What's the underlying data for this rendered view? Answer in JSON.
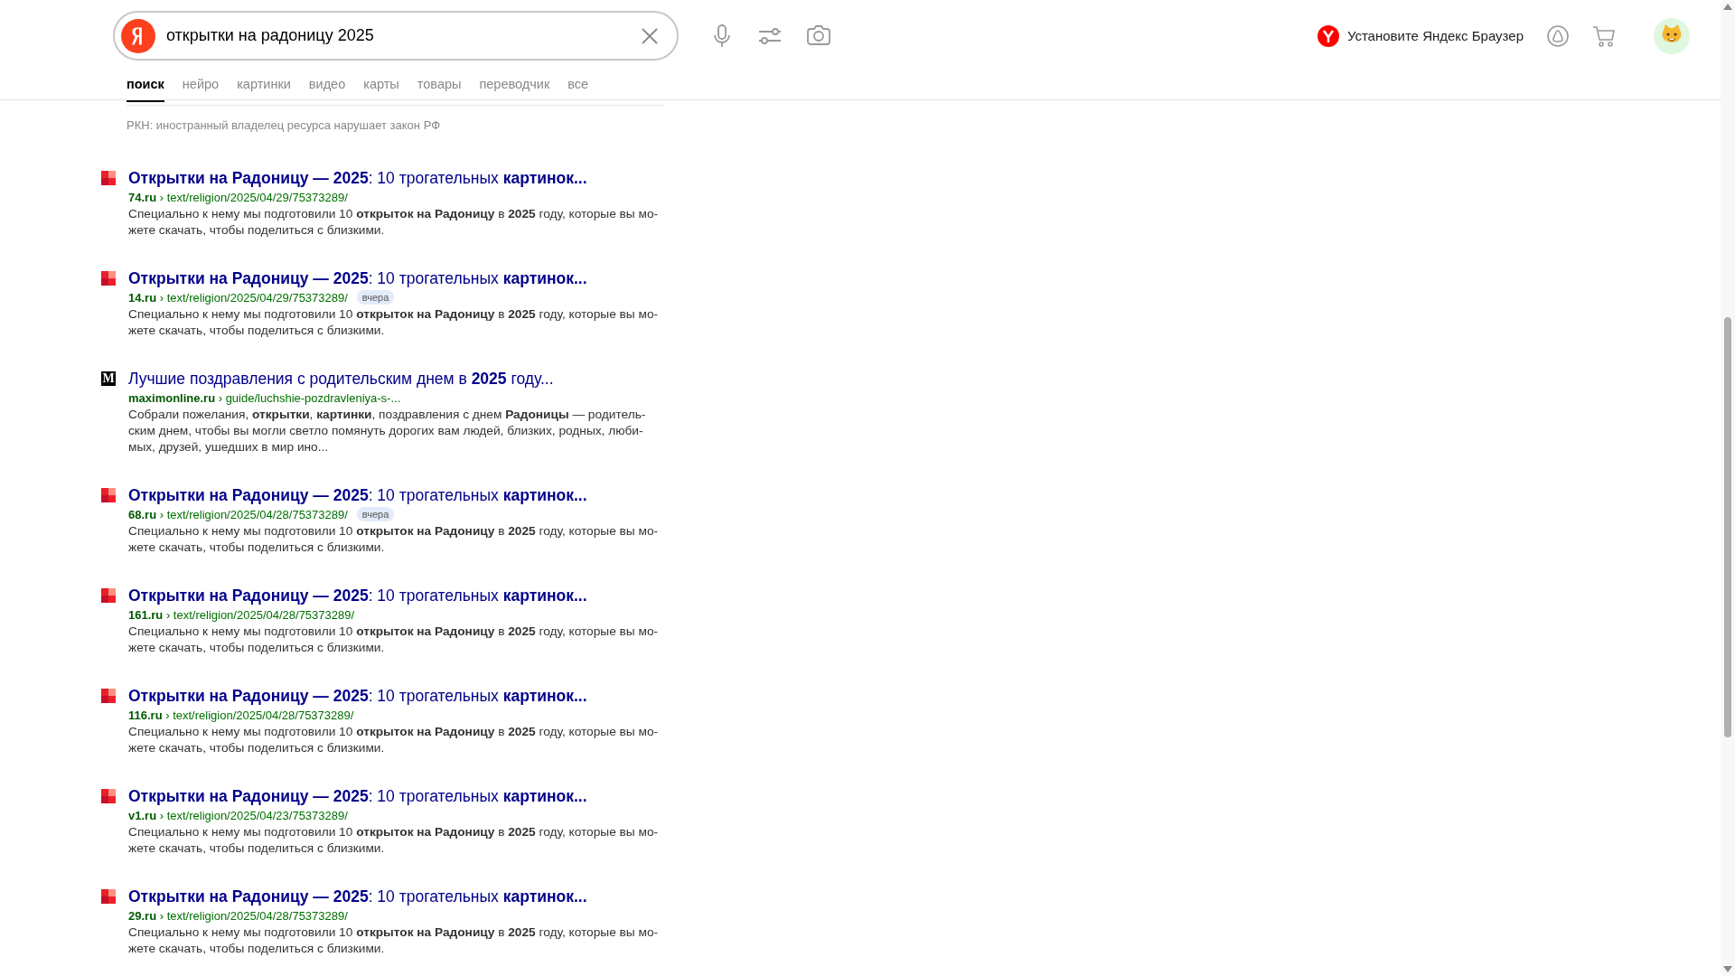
{
  "search": {
    "value": "открытки на радоницу 2025"
  },
  "promo": {
    "label": "Установите Яндекс Браузер"
  },
  "tabs": [
    {
      "label": "поиск",
      "selected": true
    },
    {
      "label": "нейро",
      "selected": false
    },
    {
      "label": "картинки",
      "selected": false
    },
    {
      "label": "видео",
      "selected": false
    },
    {
      "label": "карты",
      "selected": false
    },
    {
      "label": "товары",
      "selected": false
    },
    {
      "label": "переводчик",
      "selected": false
    },
    {
      "label": "все",
      "selected": false
    }
  ],
  "notice": "РКН: иностранный владелец ресурса нарушает закон РФ",
  "results": [
    {
      "kind": "squares",
      "title": "**Открытки на Радоницу — 2025**: 10 трогательных **картинок...**",
      "url": "**74.ru** › text/religion/2025/04/29/75373289/",
      "snippet": "Специально к нему мы подготовили 10 **открыток на Радоницу** в **2025** году, которые вы мо-\nжете скачать, чтобы поделиться с близкими."
    },
    {
      "kind": "squares",
      "title": "**Открытки на Радоницу — 2025**: 10 трогательных **картинок...**",
      "url": "**14.ru** › text/religion/2025/04/29/75373289/",
      "badge": "вчера",
      "snippet": "Специально к нему мы подготовили 10 **открыток на Радоницу** в **2025** году, которые вы мо-\nжете скачать, чтобы поделиться с близкими."
    },
    {
      "kind": "letter",
      "favicon_text": "M",
      "title": "Лучшие поздравления с родительским днем в **2025** году...",
      "url": "**maximonline.ru** › guide/luchshie-pozdravleniya-s-...",
      "snippet": "Собрали пожелания, **открытки**, **картинки**, поздравления с днем **Радоницы** — родитель-\nским днем, чтобы вы могли светло помянуть дорогих вам людей, близких, родных, люби-\nмых, друзей, ушедших в мир ино..."
    },
    {
      "kind": "squares",
      "title": "**Открытки на Радоницу — 2025**: 10 трогательных **картинок...**",
      "url": "**68.ru** › text/religion/2025/04/28/75373289/",
      "badge": "вчера",
      "snippet": "Специально к нему мы подготовили 10 **открыток на Радоницу** в **2025** году, которые вы мо-\nжете скачать, чтобы поделиться с близкими."
    },
    {
      "kind": "squares",
      "title": "**Открытки на Радоницу — 2025**: 10 трогательных **картинок...**",
      "url": "**161.ru** › text/religion/2025/04/28/75373289/",
      "snippet": "Специально к нему мы подготовили 10 **открыток на Радоницу** в **2025** году, которые вы мо-\nжете скачать, чтобы поделиться с близкими."
    },
    {
      "kind": "squares",
      "title": "**Открытки на Радоницу — 2025**: 10 трогательных **картинок...**",
      "url": "**116.ru** › text/religion/2025/04/28/75373289/",
      "snippet": "Специально к нему мы подготовили 10 **открыток на Радоницу** в **2025** году, которые вы мо-\nжете скачать, чтобы поделиться с близкими."
    },
    {
      "kind": "squares",
      "title": "**Открытки на Радоницу — 2025**: 10 трогательных **картинок...**",
      "url": "**v1.ru** › text/religion/2025/04/23/75373289/",
      "snippet": "Специально к нему мы подготовили 10 **открыток на Радоницу** в **2025** году, которые вы мо-\nжете скачать, чтобы поделиться с близкими."
    },
    {
      "kind": "squares",
      "title": "**Открытки на Радоницу — 2025**: 10 трогательных **картинок...**",
      "url": "**29.ru** › text/religion/2025/04/28/75373289/",
      "snippet": "Специально к нему мы подготовили 10 **открыток на Радоницу** в **2025** году, которые вы мо-\nжете скачать, чтобы поделиться с близкими."
    }
  ]
}
